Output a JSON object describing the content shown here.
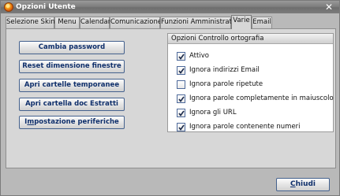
{
  "window": {
    "title": "Opzioni Utente"
  },
  "tabs": [
    {
      "label": "Selezione Skin"
    },
    {
      "label": "Menu"
    },
    {
      "label": "Calendar"
    },
    {
      "label": "Comunicazione"
    },
    {
      "label": "Funzioni Amministratore"
    },
    {
      "label": "Varie",
      "selected": true
    },
    {
      "label": "Email"
    }
  ],
  "buttons": {
    "cambia_password": "Cambia password",
    "reset_dimensione": "Reset dimensione finestre",
    "apri_cartelle_temp": "Apri cartelle temporanee",
    "apri_cartella_doc": "Apri cartella doc Estratti",
    "impostazione_pre": "I",
    "impostazione_u": "m",
    "impostazione_post": "postazione periferiche"
  },
  "spell_check": {
    "header": "Opzioni Controllo ortografia",
    "options": [
      {
        "label": "Attivo",
        "checked": true
      },
      {
        "label": "Ignora indirizzi Email",
        "checked": true
      },
      {
        "label": "Ignora parole ripetute",
        "checked": false
      },
      {
        "label": "Ignora parole completamente in maiuscolo",
        "checked": true
      },
      {
        "label": "Ignora gli URL",
        "checked": true
      },
      {
        "label": "Ignora parole contenente numeri",
        "checked": true
      }
    ]
  },
  "footer": {
    "close_u": "C",
    "close_rest": "hiudi"
  },
  "icons": {
    "app": "app-logo-icon",
    "close": "close-icon",
    "check": "checkmark-icon"
  },
  "colors": {
    "button_text": "#0f2f6b",
    "button_border": "#45628e",
    "titlebar": "#7e7e7e",
    "checkmark": "#1b2a4a"
  }
}
